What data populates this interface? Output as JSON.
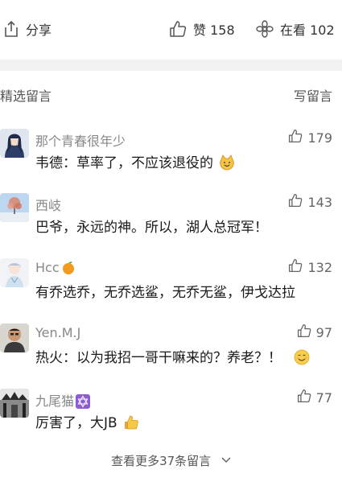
{
  "actions": {
    "share_label": "分享",
    "like_label": "赞 158",
    "watch_label": "在看 102"
  },
  "section": {
    "title": "精选留言",
    "write_label": "写留言"
  },
  "comments": [
    {
      "nickname": "那个青春很年少",
      "likes": "179",
      "text": "韦德：草率了，不应该退役的"
    },
    {
      "nickname": "西岐",
      "likes": "143",
      "text": "巴爷，永远的神。所以，湖人总冠军！"
    },
    {
      "nickname": "Hcc",
      "likes": "132",
      "text": "有乔选乔，无乔选鲨，无乔无鲨，伊戈达拉"
    },
    {
      "nickname": "Yen.M.J",
      "likes": "97",
      "text": "热火：以为我招一哥干嘛来的？养老？！"
    },
    {
      "nickname": "九尾猫",
      "likes": "77",
      "text": "厉害了，大JB"
    }
  ],
  "footer": {
    "more_label": "查看更多37条留言"
  },
  "icons": {
    "share": "share-icon",
    "like": "thumbs-up-icon",
    "watch": "flower-icon",
    "chevron": "chevron-down-icon"
  },
  "colors": {
    "separator": "#f2f2f2",
    "muted_text": "#888888",
    "body_text": "#1a1a1a"
  }
}
